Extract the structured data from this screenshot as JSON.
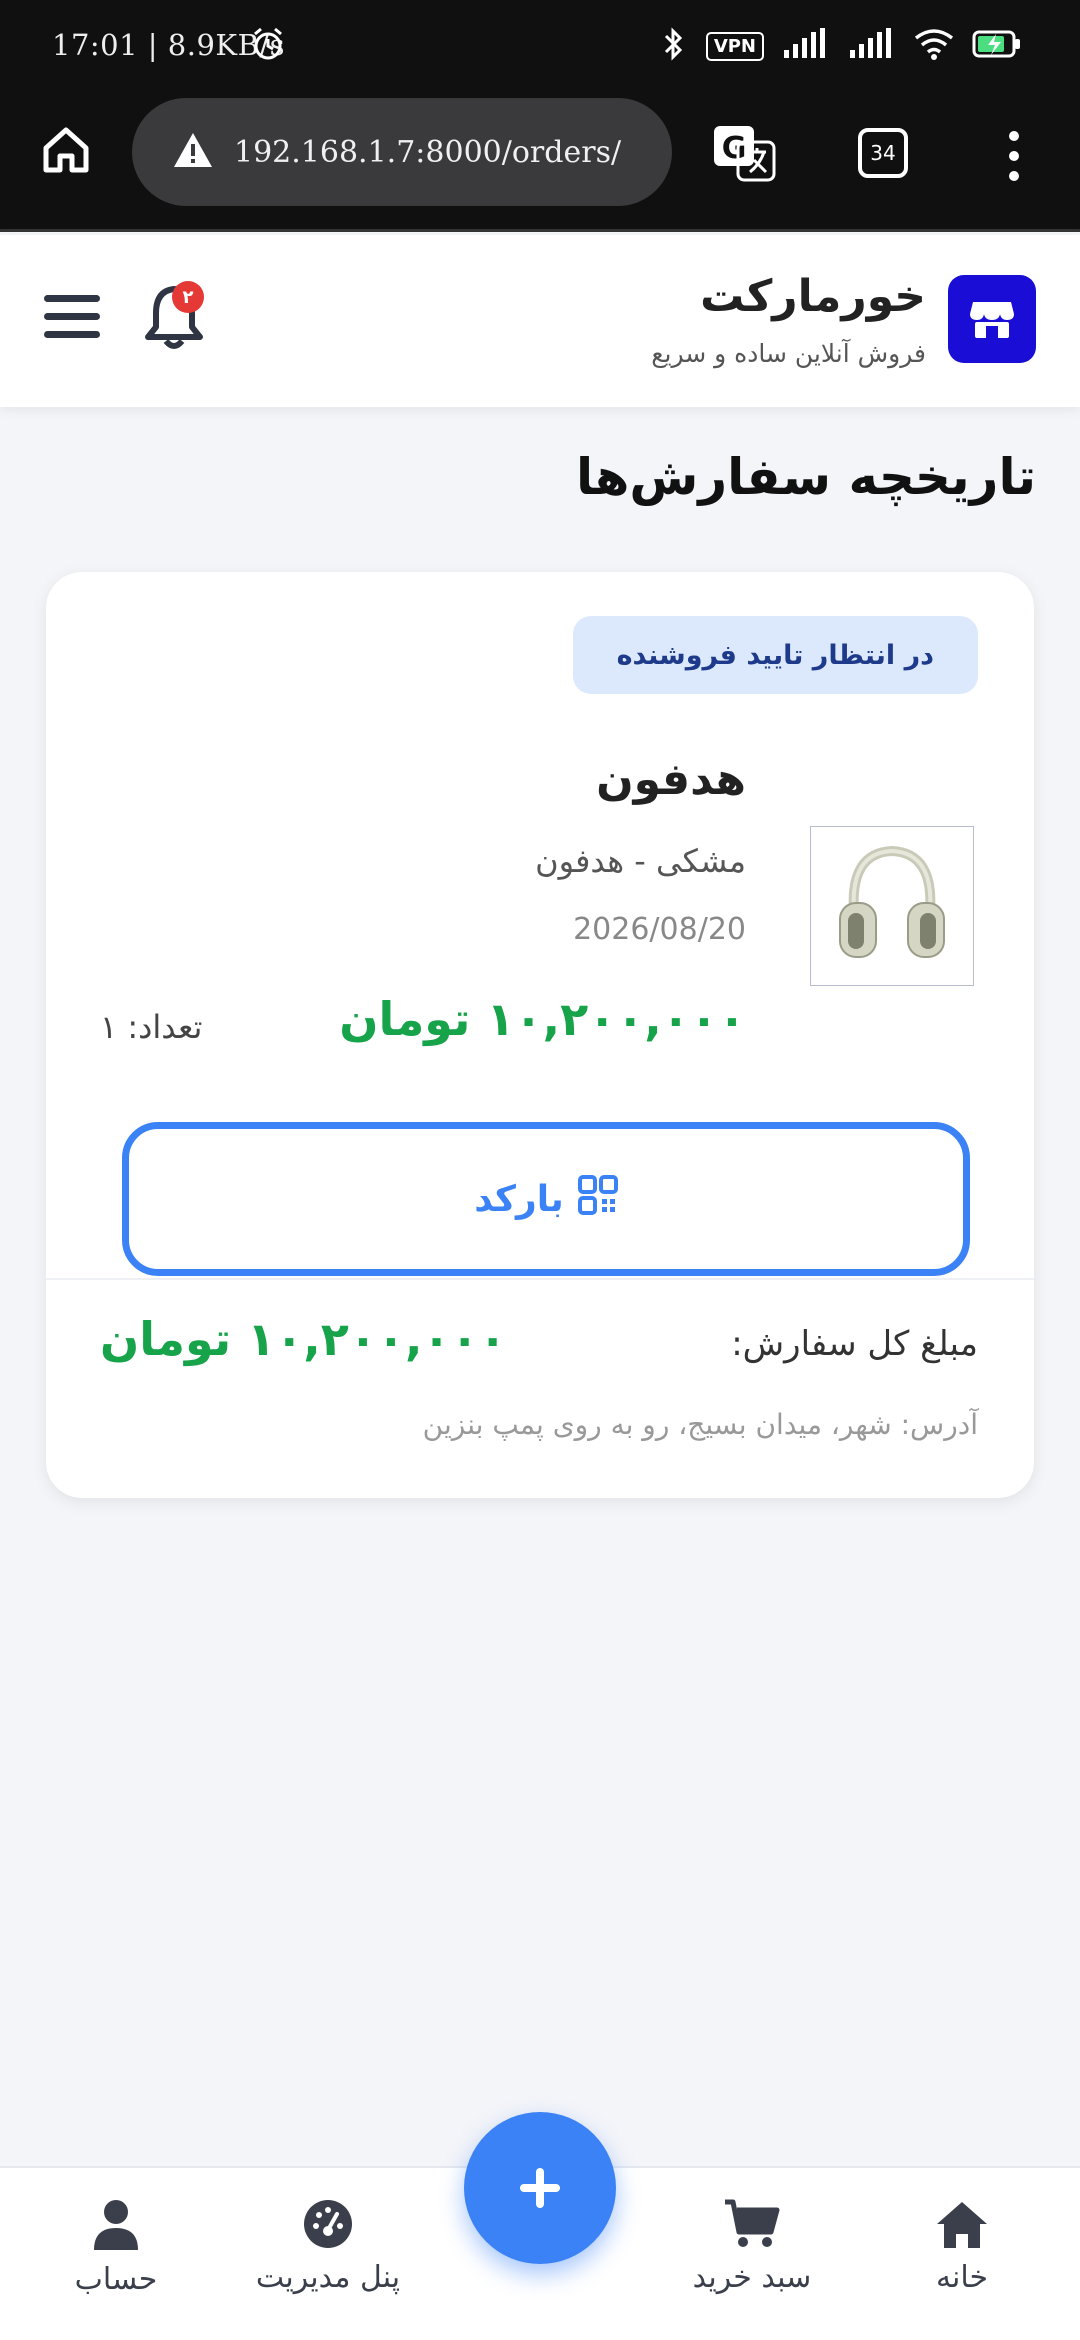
{
  "status_bar": {
    "time": "17:01",
    "net_speed": "8.9KB/s",
    "vpn_label": "VPN"
  },
  "browser": {
    "url": "192.168.1.7:8000/orders/",
    "tab_count": "34"
  },
  "header": {
    "brand_name": "خورمارکت",
    "brand_tagline": "فروش آنلاین ساده و سریع",
    "notification_count": "۲"
  },
  "page": {
    "title": "تاریخچه سفارش‌ها"
  },
  "order": {
    "status": "در انتظار تایید فروشنده",
    "product_name": "هدفون",
    "variant": "مشکی - هدفون",
    "date": "2026/08/20",
    "price": "۱۰,۲۰۰,۰۰۰ تومان",
    "quantity": "تعداد: ۱",
    "barcode_label": "بارکد",
    "total_label": "مبلغ کل سفارش:",
    "total_value": "۱۰,۲۰۰,۰۰۰ تومان",
    "address": "آدرس: شهر، میدان بسیج، رو به روی پمپ بنزین"
  },
  "bottom_nav": {
    "home": "خانه",
    "cart": "سبد خرید",
    "admin_panel": "پنل مدیریت",
    "account": "حساب"
  },
  "colors": {
    "brand": "#1a0dd6",
    "accent": "#3b82f6",
    "price": "#16a34a",
    "badge_bg": "#dce9fc"
  }
}
